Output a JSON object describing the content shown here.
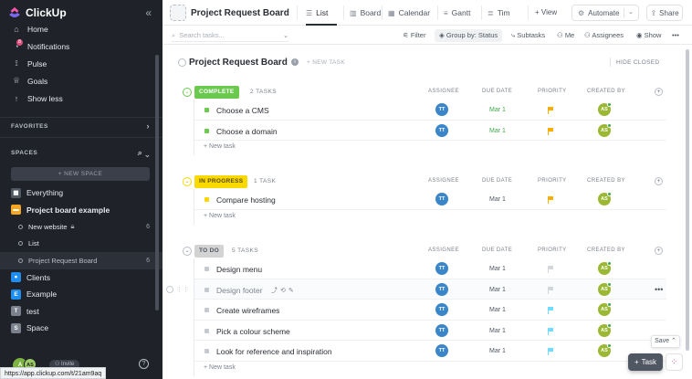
{
  "app": {
    "name": "ClickUp"
  },
  "sidebar": {
    "nav": [
      {
        "label": "Home",
        "icon": "home-icon"
      },
      {
        "label": "Notifications",
        "icon": "bell-icon",
        "badge": "8"
      },
      {
        "label": "Pulse",
        "icon": "pulse-icon"
      },
      {
        "label": "Goals",
        "icon": "trophy-icon"
      },
      {
        "label": "Show less",
        "icon": "arrow-up-icon"
      }
    ],
    "favorites_label": "FAVORITES",
    "spaces_label": "SPACES",
    "new_space_label": "+ NEW SPACE",
    "spaces": [
      {
        "label": "Everything",
        "kind": "everything"
      },
      {
        "label": "Project board example",
        "kind": "space",
        "letter": "",
        "color": "#f5a623"
      },
      {
        "label": "New website",
        "kind": "list",
        "count": "6",
        "locked": true
      },
      {
        "label": "List",
        "kind": "list",
        "count": ""
      },
      {
        "label": "Project Request Board",
        "kind": "list",
        "count": "6",
        "active": true
      },
      {
        "label": "Clients",
        "kind": "space",
        "letter": "",
        "color": "#1f8ef1"
      },
      {
        "label": "Example",
        "kind": "space",
        "letter": "E",
        "color": "#1f8ef1"
      },
      {
        "label": "test",
        "kind": "space",
        "letter": "T",
        "color": "#7c828d"
      },
      {
        "label": "Space",
        "kind": "space",
        "letter": "S",
        "color": "#7c828d"
      }
    ],
    "avatar_initials": "AS",
    "invite_label": "Invite",
    "help_label": "?"
  },
  "status_url": "https://app.clickup.com/t/21am9aq",
  "topbar": {
    "title": "Project Request Board",
    "tabs": [
      {
        "label": "List",
        "icon": "list-icon",
        "active": true
      },
      {
        "label": "Board",
        "icon": "board-icon"
      },
      {
        "label": "Calendar",
        "icon": "calendar-icon"
      },
      {
        "label": "Gantt",
        "icon": "gantt-icon"
      },
      {
        "label": "Tim",
        "icon": "timeline-icon"
      }
    ],
    "add_view_label": "+ View",
    "automate_label": "Automate",
    "share_label": "Share"
  },
  "filterbar": {
    "search_placeholder": "Search tasks...",
    "filter_label": "Filter",
    "groupby_label": "Group by: Status",
    "subtasks_label": "Subtasks",
    "me_label": "Me",
    "assignees_label": "Assignees",
    "show_label": "Show",
    "more_label": "•••"
  },
  "list": {
    "title": "Project Request Board",
    "new_task_label": "+ NEW TASK",
    "hide_closed_label": "HIDE CLOSED",
    "columns": {
      "assignee": "ASSIGNEE",
      "due": "DUE DATE",
      "priority": "PRIORITY",
      "created": "CREATED BY"
    },
    "add_row_label": "+ New task",
    "groups": [
      {
        "status": "COMPLETE",
        "count": "2 TASKS",
        "color": "#6bc950",
        "text_color": "#ffffff",
        "tasks": [
          {
            "name": "Choose a CMS",
            "assignee": "TT",
            "due": "Mar 1",
            "due_green": true,
            "flag": "#f8ae00",
            "creator": "AS"
          },
          {
            "name": "Choose a domain",
            "assignee": "TT",
            "due": "Mar 1",
            "due_green": true,
            "flag": "#f8ae00",
            "creator": "AS"
          }
        ]
      },
      {
        "status": "IN PROGRESS",
        "count": "1 TASK",
        "color": "#f9d900",
        "text_color": "#5a4a00",
        "tasks": [
          {
            "name": "Compare hosting",
            "assignee": "TT",
            "due": "Mar 1",
            "due_green": false,
            "flag": "#f8ae00",
            "creator": "AS"
          }
        ]
      },
      {
        "status": "TO DO",
        "count": "5 TASKS",
        "color": "#d3d3d3",
        "text_color": "#4f5762",
        "tasks": [
          {
            "name": "Design menu",
            "assignee": "TT",
            "due": "Mar 1",
            "due_green": false,
            "flag": "#d3d6db",
            "creator": "AS"
          },
          {
            "name": "Design footer",
            "assignee": "TT",
            "due": "Mar 1",
            "due_green": false,
            "flag": "#d3d6db",
            "creator": "AS",
            "hovered": true
          },
          {
            "name": "Create wireframes",
            "assignee": "TT",
            "due": "Mar 1",
            "due_green": false,
            "flag": "#6fddff",
            "creator": "AS"
          },
          {
            "name": "Pick a colour scheme",
            "assignee": "TT",
            "due": "Mar 1",
            "due_green": false,
            "flag": "#6fddff",
            "creator": "AS"
          },
          {
            "name": "Look for reference and inspiration",
            "assignee": "TT",
            "due": "Mar 1",
            "due_green": false,
            "flag": "#6fddff",
            "creator": "AS"
          }
        ]
      }
    ]
  },
  "floating": {
    "save_label": "Save",
    "task_label": "Task"
  }
}
